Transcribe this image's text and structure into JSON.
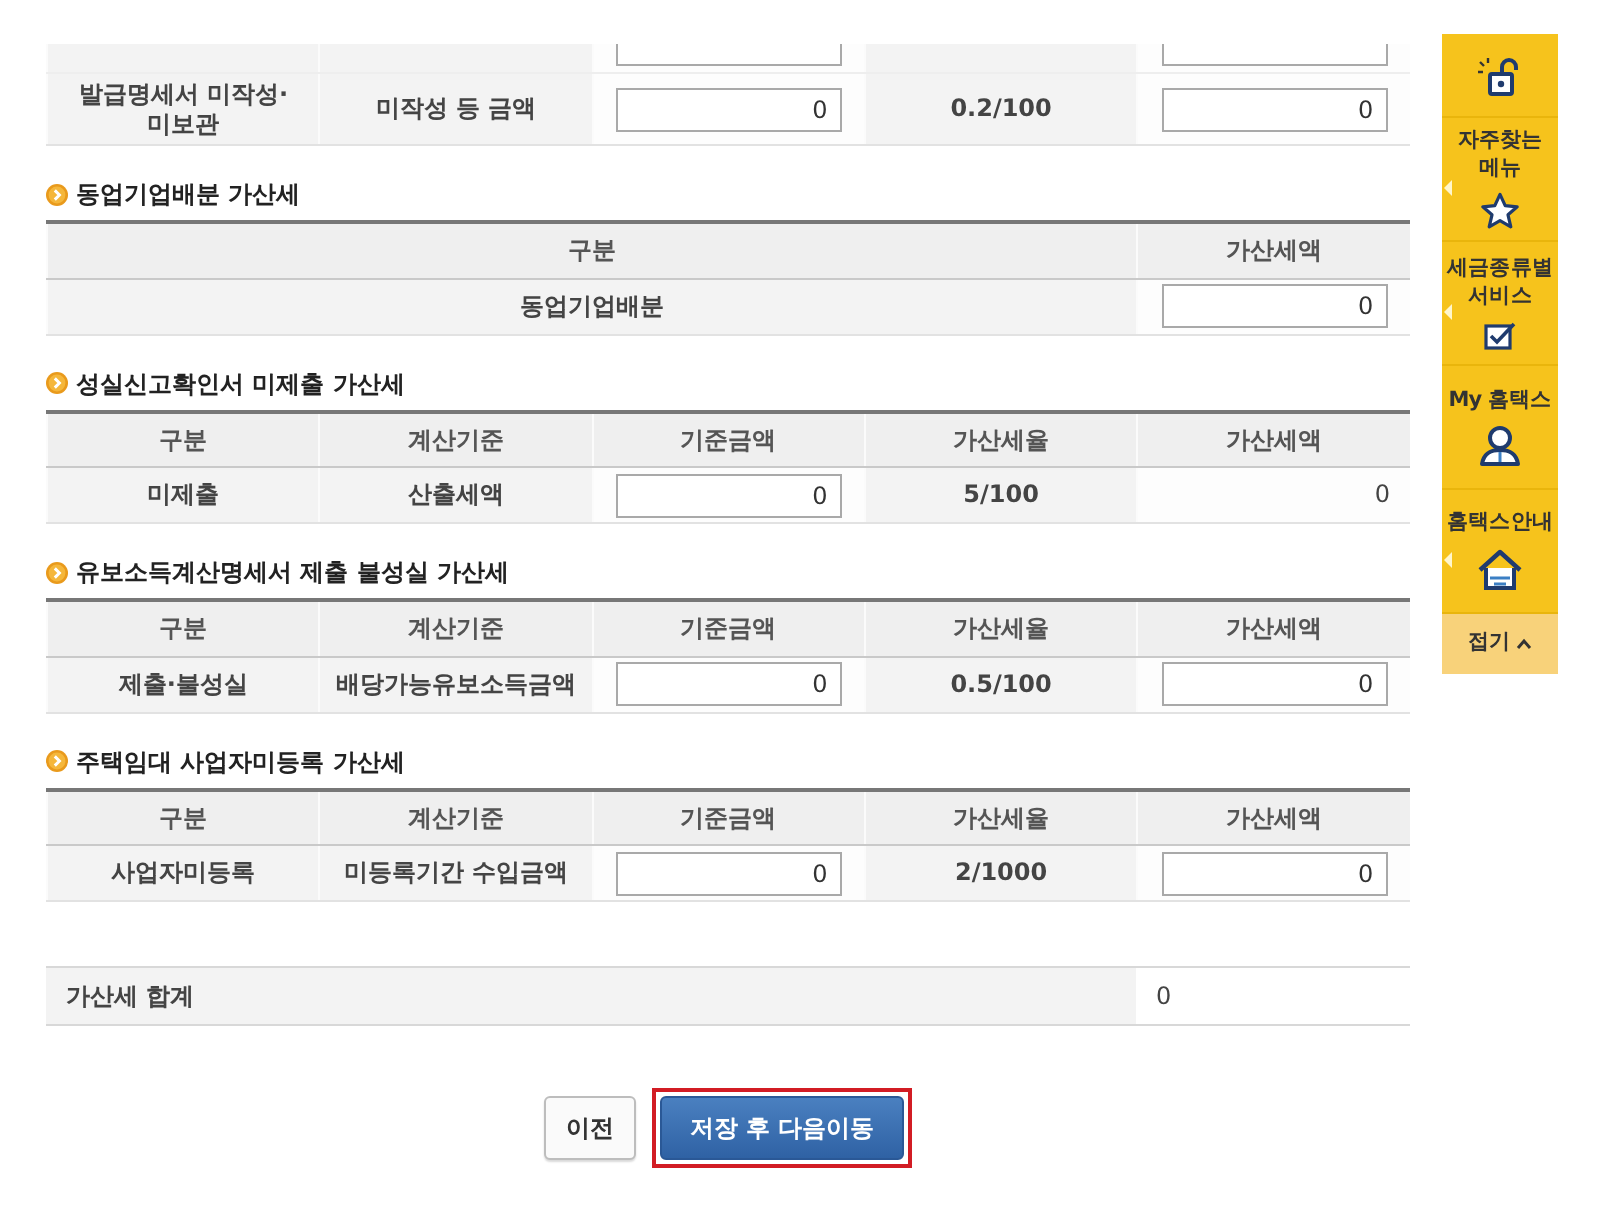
{
  "top_table": {
    "rows": [
      {
        "cut": true,
        "cells": [
          {
            "kind": "label"
          },
          {
            "kind": "label"
          },
          {
            "kind": "input"
          },
          {
            "kind": "label"
          },
          {
            "kind": "input"
          }
        ]
      },
      {
        "cut": false,
        "cells": [
          {
            "kind": "label",
            "text": "발급명세서 미작성·미보관"
          },
          {
            "kind": "label",
            "text": "미작성 등 금액"
          },
          {
            "kind": "input",
            "value": "0"
          },
          {
            "kind": "label",
            "text": "0.2/100"
          },
          {
            "kind": "input",
            "value": "0"
          }
        ]
      }
    ]
  },
  "sections": [
    {
      "title": "동업기업배분 가산세",
      "columns": [
        "구분",
        "가산세액"
      ],
      "rows": [
        {
          "cells": [
            {
              "kind": "label",
              "text": "동업기업배분"
            },
            {
              "kind": "input",
              "value": "0"
            }
          ]
        }
      ]
    },
    {
      "title": "성실신고확인서 미제출 가산세",
      "columns": [
        "구분",
        "계산기준",
        "기준금액",
        "가산세율",
        "가산세액"
      ],
      "rows": [
        {
          "cells": [
            {
              "kind": "label",
              "text": "미제출"
            },
            {
              "kind": "label",
              "text": "산출세액"
            },
            {
              "kind": "input",
              "value": "0"
            },
            {
              "kind": "label",
              "text": "5/100"
            },
            {
              "kind": "amount",
              "text": "0"
            }
          ]
        }
      ]
    },
    {
      "title": "유보소득계산명세서 제출 불성실 가산세",
      "columns": [
        "구분",
        "계산기준",
        "기준금액",
        "가산세율",
        "가산세액"
      ],
      "rows": [
        {
          "cells": [
            {
              "kind": "label",
              "text": "제출·불성실"
            },
            {
              "kind": "label",
              "text": "배당가능유보소득금액"
            },
            {
              "kind": "input",
              "value": "0"
            },
            {
              "kind": "label",
              "text": "0.5/100"
            },
            {
              "kind": "input",
              "value": "0"
            }
          ]
        }
      ]
    },
    {
      "title": "주택임대 사업자미등록 가산세",
      "columns": [
        "구분",
        "계산기준",
        "기준금액",
        "가산세율",
        "가산세액"
      ],
      "rows": [
        {
          "cells": [
            {
              "kind": "label",
              "text": "사업자미등록"
            },
            {
              "kind": "label",
              "text": "미등록기간 수입금액"
            },
            {
              "kind": "input",
              "value": "0"
            },
            {
              "kind": "label",
              "text": "2/1000"
            },
            {
              "kind": "input",
              "value": "0"
            }
          ]
        }
      ]
    }
  ],
  "total": {
    "label": "가산세 합계",
    "value": "0"
  },
  "buttons": [
    {
      "label": "이전",
      "kind": "secondary",
      "highlighted": false
    },
    {
      "label": "저장 후 다음이동",
      "kind": "primary",
      "highlighted": true
    }
  ],
  "quick_menu": {
    "items": [
      {
        "has_submenu": false
      },
      {
        "label": "자주찾는 메뉴",
        "has_submenu": true
      },
      {
        "label": "세금종류별 서비스",
        "has_submenu": true
      },
      {
        "label": "My 홈택스",
        "has_submenu": false
      },
      {
        "label": "홈택스안내",
        "has_submenu": true
      }
    ],
    "collapse": {
      "label": "접기"
    }
  }
}
